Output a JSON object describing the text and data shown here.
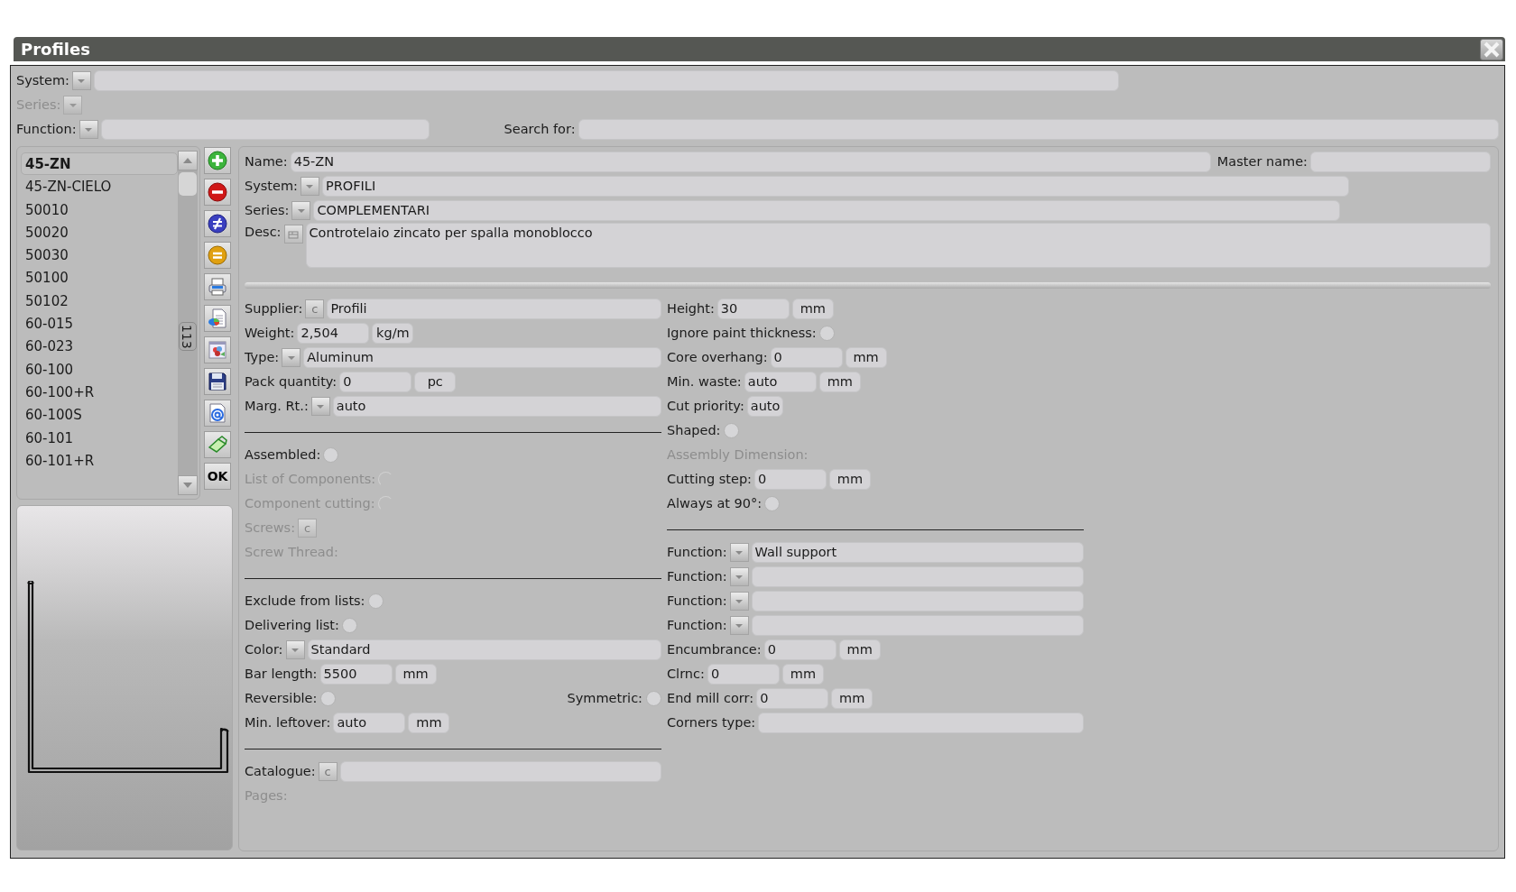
{
  "window": {
    "title": "Profiles"
  },
  "filters": {
    "system": {
      "label": "System:"
    },
    "series": {
      "label": "Series:",
      "disabled": true
    },
    "function": {
      "label": "Function:"
    },
    "search": {
      "label": "Search for:"
    }
  },
  "list": {
    "count": "113",
    "items": [
      {
        "label": "45-ZN",
        "selected": true
      },
      {
        "label": "45-ZN-CIELO",
        "selected": false
      },
      {
        "label": "50010",
        "selected": false
      },
      {
        "label": "50020",
        "selected": false
      },
      {
        "label": "50030",
        "selected": false
      },
      {
        "label": "50100",
        "selected": false
      },
      {
        "label": "50102",
        "selected": false
      },
      {
        "label": "60-015",
        "selected": false
      },
      {
        "label": "60-023",
        "selected": false
      },
      {
        "label": "60-100",
        "selected": false
      },
      {
        "label": "60-100+R",
        "selected": false
      },
      {
        "label": "60-100S",
        "selected": false
      },
      {
        "label": "60-101",
        "selected": false
      },
      {
        "label": "60-101+R",
        "selected": false
      }
    ]
  },
  "toolbar": [
    {
      "kind": "add"
    },
    {
      "kind": "remove"
    },
    {
      "kind": "not-equal"
    },
    {
      "kind": "equal"
    },
    {
      "kind": "print"
    },
    {
      "kind": "report"
    },
    {
      "kind": "preview"
    },
    {
      "kind": "save"
    },
    {
      "kind": "mail"
    },
    {
      "kind": "edit"
    },
    {
      "kind": "ok",
      "label": "OK"
    }
  ],
  "header": {
    "name": {
      "label": "Name:",
      "value": "45-ZN"
    },
    "master_name": {
      "label": "Master name:"
    },
    "system": {
      "label": "System:",
      "value": "PROFILI"
    },
    "series": {
      "label": "Series:",
      "value": "COMPLEMENTARI"
    },
    "desc": {
      "label": "Desc:",
      "value": "Controtelaio zincato per spalla monoblocco"
    }
  },
  "left_column": [
    {
      "kind": "lookup",
      "label": "Supplier:",
      "button": "c",
      "value": "Profili",
      "disabled": false
    },
    {
      "kind": "number",
      "label": "Weight:",
      "value": "2,504",
      "unit": "kg/m",
      "disabled": false
    },
    {
      "kind": "combo",
      "label": "Type:",
      "value": "Aluminum",
      "disabled": false
    },
    {
      "kind": "number",
      "label": "Pack quantity:",
      "value": "0",
      "unit": "pc",
      "disabled": false
    },
    {
      "kind": "combo",
      "label": "Marg. Rt.:",
      "value": "auto",
      "disabled": false
    },
    {
      "kind": "divider"
    },
    {
      "kind": "radio",
      "label": "Assembled:",
      "checked": false,
      "disabled": false
    },
    {
      "kind": "radio",
      "label": "List of Components:",
      "checked": false,
      "disabled": true
    },
    {
      "kind": "radio",
      "label": "Component cutting:",
      "checked": false,
      "disabled": true
    },
    {
      "kind": "button",
      "label": "Screws:",
      "button": "c",
      "disabled": true
    },
    {
      "kind": "plain",
      "label": "Screw Thread:",
      "disabled": true
    },
    {
      "kind": "divider"
    },
    {
      "kind": "radio",
      "label": "Exclude from lists:",
      "checked": false,
      "disabled": false
    },
    {
      "kind": "radio",
      "label": "Delivering list:",
      "checked": false,
      "disabled": false
    },
    {
      "kind": "combo",
      "label": "Color:",
      "value": "Standard",
      "disabled": false
    },
    {
      "kind": "number",
      "label": "Bar length:",
      "value": "5500",
      "unit": "mm",
      "disabled": false
    },
    {
      "kind": "pair",
      "left": {
        "label": "Reversible:",
        "checked": false
      },
      "right": {
        "label": "Symmetric:",
        "checked": false
      },
      "disabled": false
    },
    {
      "kind": "number",
      "label": "Min. leftover:",
      "value": "auto",
      "unit": "mm",
      "disabled": false
    },
    {
      "kind": "divider"
    },
    {
      "kind": "lookup",
      "label": "Catalogue:",
      "button": "c",
      "disabled": false
    },
    {
      "kind": "plain",
      "label": "Pages:",
      "disabled": true
    }
  ],
  "right_column": [
    {
      "kind": "number",
      "label": "Height:",
      "value": "30",
      "unit": "mm",
      "disabled": false
    },
    {
      "kind": "radio",
      "label": "Ignore paint thickness:",
      "checked": false,
      "disabled": false
    },
    {
      "kind": "number",
      "label": "Core overhang:",
      "value": "0",
      "unit": "mm",
      "disabled": false
    },
    {
      "kind": "number",
      "label": "Min. waste:",
      "value": "auto",
      "unit": "mm",
      "disabled": false
    },
    {
      "kind": "fixed",
      "label": "Cut priority:",
      "value": "auto",
      "disabled": false
    },
    {
      "kind": "radio",
      "label": "Shaped:",
      "checked": false,
      "disabled": false
    },
    {
      "kind": "plain",
      "label": "Assembly Dimension:",
      "disabled": true
    },
    {
      "kind": "number",
      "label": "Cutting step:",
      "value": "0",
      "unit": "mm",
      "disabled": false
    },
    {
      "kind": "radio",
      "label": "Always at 90°:",
      "checked": false,
      "disabled": false
    },
    {
      "kind": "divider"
    },
    {
      "kind": "combo",
      "label": "Function:",
      "value": "Wall support",
      "disabled": false
    },
    {
      "kind": "combo",
      "label": "Function:",
      "disabled": false
    },
    {
      "kind": "combo",
      "label": "Function:",
      "disabled": false
    },
    {
      "kind": "combo",
      "label": "Function:",
      "disabled": false
    },
    {
      "kind": "number",
      "label": "Encumbrance:",
      "value": "0",
      "unit": "mm",
      "disabled": false
    },
    {
      "kind": "number",
      "label": "Clrnc:",
      "value": "0",
      "unit": "mm",
      "disabled": false
    },
    {
      "kind": "number",
      "label": "End mill corr:",
      "value": "0",
      "unit": "mm",
      "disabled": false
    },
    {
      "kind": "text",
      "label": "Corners type:",
      "disabled": false
    }
  ]
}
